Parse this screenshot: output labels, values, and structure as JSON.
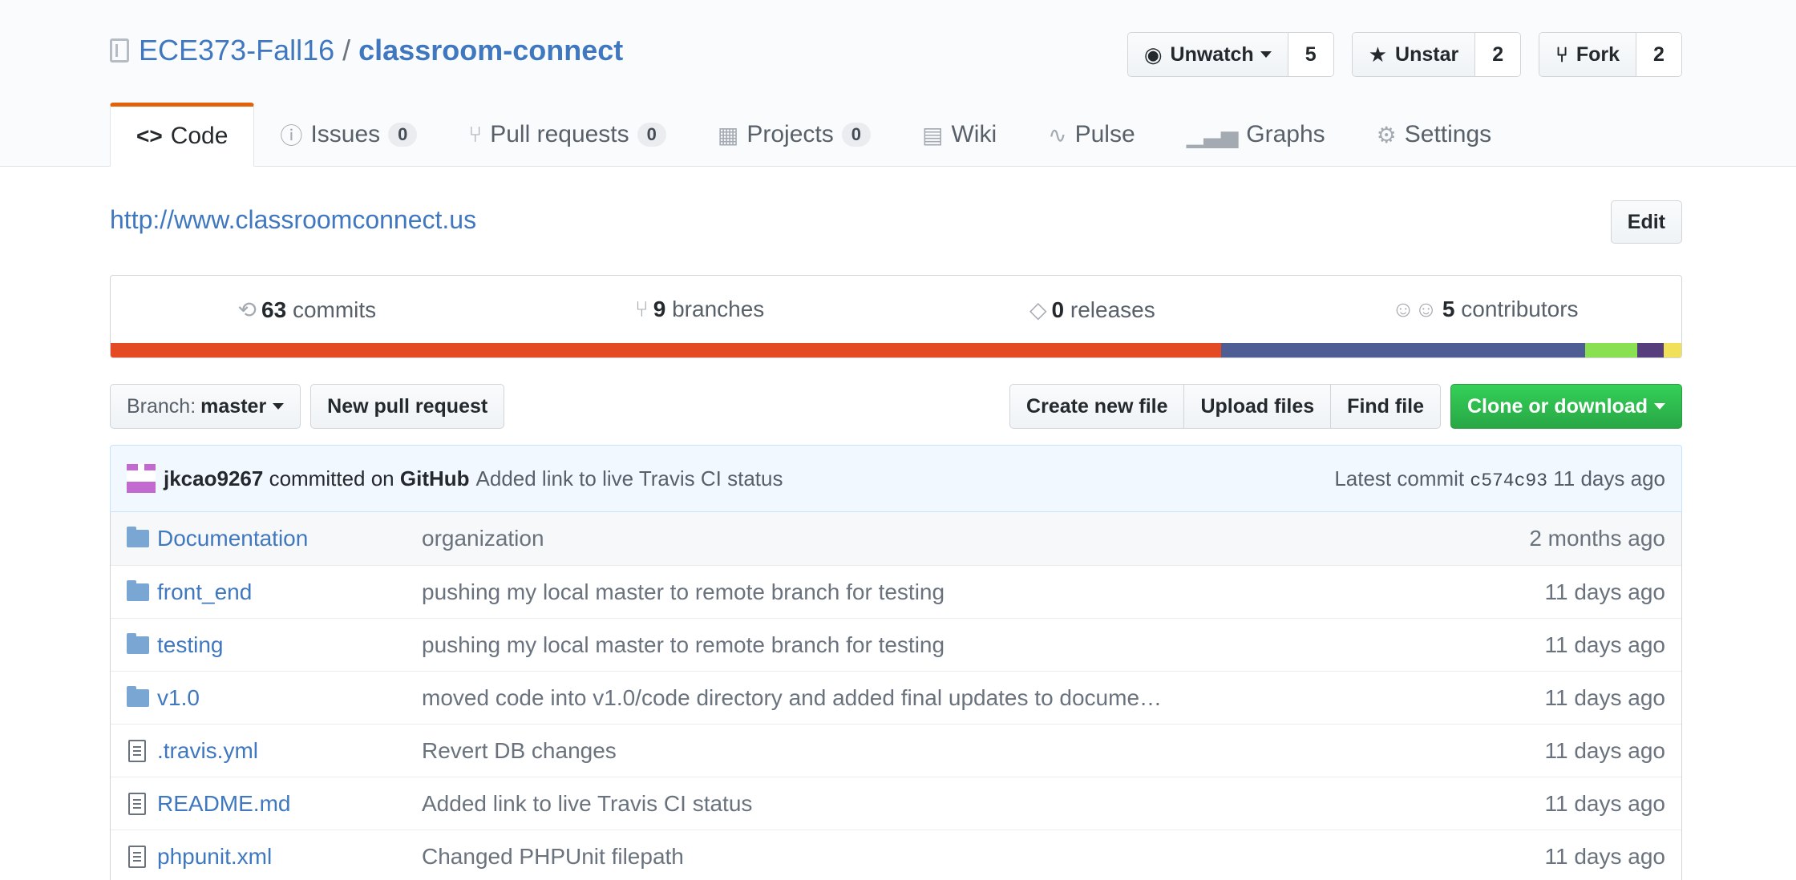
{
  "repo": {
    "owner": "ECE373-Fall16",
    "separator": "/",
    "name": "classroom-connect"
  },
  "actions": {
    "watch": {
      "label": "Unwatch",
      "count": "5"
    },
    "star": {
      "label": "Unstar",
      "count": "2"
    },
    "fork": {
      "label": "Fork",
      "count": "2"
    }
  },
  "tabs": [
    {
      "label": "Code",
      "icon": "code-icon"
    },
    {
      "label": "Issues",
      "count": "0",
      "icon": "issue-icon"
    },
    {
      "label": "Pull requests",
      "count": "0",
      "icon": "pull-request-icon"
    },
    {
      "label": "Projects",
      "count": "0",
      "icon": "project-icon"
    },
    {
      "label": "Wiki",
      "icon": "book-icon"
    },
    {
      "label": "Pulse",
      "icon": "pulse-icon"
    },
    {
      "label": "Graphs",
      "icon": "graph-icon"
    },
    {
      "label": "Settings",
      "icon": "gear-icon"
    }
  ],
  "description": {
    "link": "http://www.classroomconnect.us",
    "edit_label": "Edit"
  },
  "summary": {
    "commits": {
      "count": "63",
      "label": "commits"
    },
    "branches": {
      "count": "9",
      "label": "branches"
    },
    "releases": {
      "count": "0",
      "label": "releases"
    },
    "contributors": {
      "count": "5",
      "label": "contributors"
    }
  },
  "languages": [
    {
      "share": 70.7,
      "color": "#e44b23"
    },
    {
      "share": 23.2,
      "color": "#4f5d95"
    },
    {
      "share": 3.3,
      "color": "#89e051"
    },
    {
      "share": 1.7,
      "color": "#563d7c"
    },
    {
      "share": 1.1,
      "color": "#f1e05a"
    }
  ],
  "filebar": {
    "branch_prefix": "Branch:",
    "branch": "master",
    "new_pr": "New pull request",
    "create_file": "Create new file",
    "upload": "Upload files",
    "find": "Find file",
    "clone": "Clone or download"
  },
  "latest_commit": {
    "author": "jkcao9267",
    "committed_on": "committed on",
    "platform": "GitHub",
    "message": "Added link to live Travis CI status",
    "prefix": "Latest commit",
    "sha": "c574c93",
    "age": "11 days ago"
  },
  "files": [
    {
      "type": "dir",
      "name": "Documentation",
      "message": "organization",
      "age": "2 months ago"
    },
    {
      "type": "dir",
      "name": "front_end",
      "message": "pushing my local master to remote branch for testing",
      "age": "11 days ago"
    },
    {
      "type": "dir",
      "name": "testing",
      "message": "pushing my local master to remote branch for testing",
      "age": "11 days ago"
    },
    {
      "type": "dir",
      "name": "v1.0",
      "message": "moved code into v1.0/code directory and added final updates to docume…",
      "age": "11 days ago"
    },
    {
      "type": "file",
      "name": ".travis.yml",
      "message": "Revert DB changes",
      "age": "11 days ago"
    },
    {
      "type": "file",
      "name": "README.md",
      "message": "Added link to live Travis CI status",
      "age": "11 days ago"
    },
    {
      "type": "file",
      "name": "phpunit.xml",
      "message": "Changed PHPUnit filepath",
      "age": "11 days ago"
    }
  ]
}
